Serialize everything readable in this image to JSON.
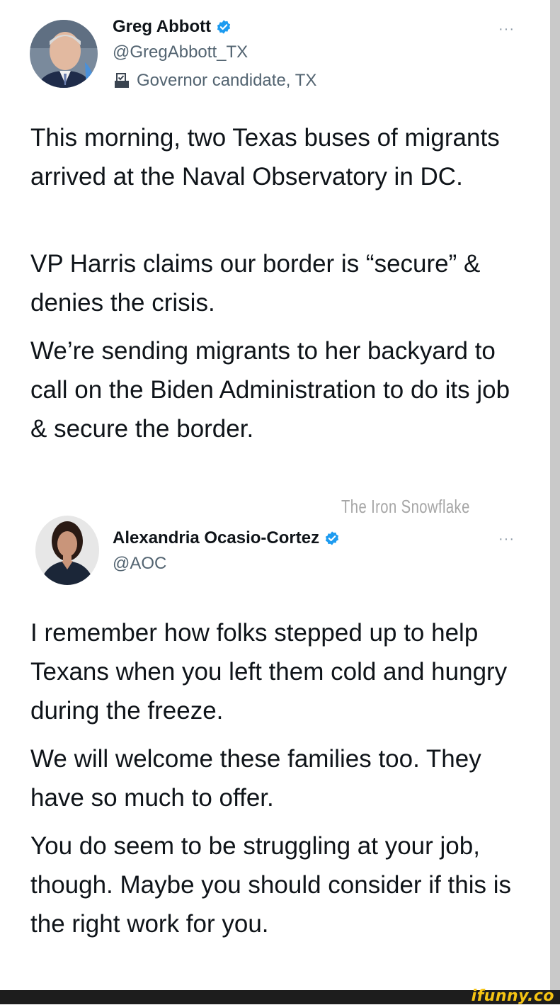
{
  "tweet1": {
    "name": "Greg Abbott",
    "handle": "@GregAbbott_TX",
    "label": "Governor candidate, TX",
    "label_icon": "ballot-box-icon",
    "more": "···",
    "paragraphs": [
      "This morning, two Texas buses of migrants arrived at the Naval Observatory in DC.",
      "VP Harris claims our border is “secure” & denies the crisis.",
      "We’re sending migrants to her backyard to call on the Biden Administration to do its job & secure the border."
    ]
  },
  "watermark": "The Iron Snowflake",
  "tweet2": {
    "name": "Alexandria Ocasio-Cortez",
    "handle": "@AOC",
    "more": "···",
    "paragraphs": [
      "I remember how folks stepped up to help Texans when you left them cold and hungry during the freeze.",
      "We will welcome these families too. They have so much to offer.",
      "You do seem to be struggling at your job, though. Maybe you should consider if this is the right work for you."
    ]
  },
  "footer": {
    "brand": "ifunny.co"
  },
  "colors": {
    "verified": "#1d9bf0",
    "brand": "#f6c413",
    "text": "#0f1419",
    "secondary": "#536471"
  }
}
